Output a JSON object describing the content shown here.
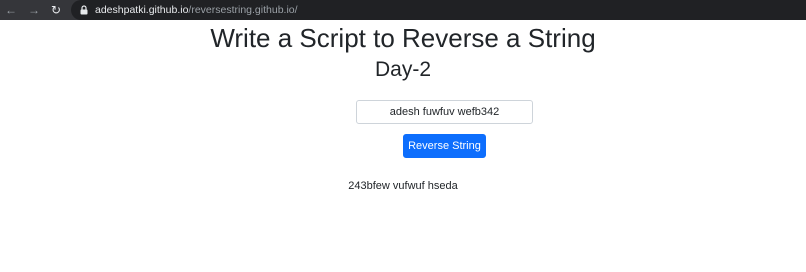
{
  "browser": {
    "url_host": "adeshpatki.github.io",
    "url_path": "/reversestring.github.io/",
    "icons": {
      "back": "arrow-left-icon",
      "forward": "arrow-right-icon",
      "reload": "reload-icon",
      "lock": "lock-icon"
    }
  },
  "page": {
    "title": "Write a Script to Reverse a String",
    "subtitle": "Day-2",
    "input_value": "adesh fuwfuv wefb342",
    "button_label": "Reverse String",
    "result": "243bfew vufwuf hseda"
  },
  "colors": {
    "chrome_bar": "#35363a",
    "omnibox": "#202124",
    "button": "#0d6efd",
    "text": "#212529"
  }
}
